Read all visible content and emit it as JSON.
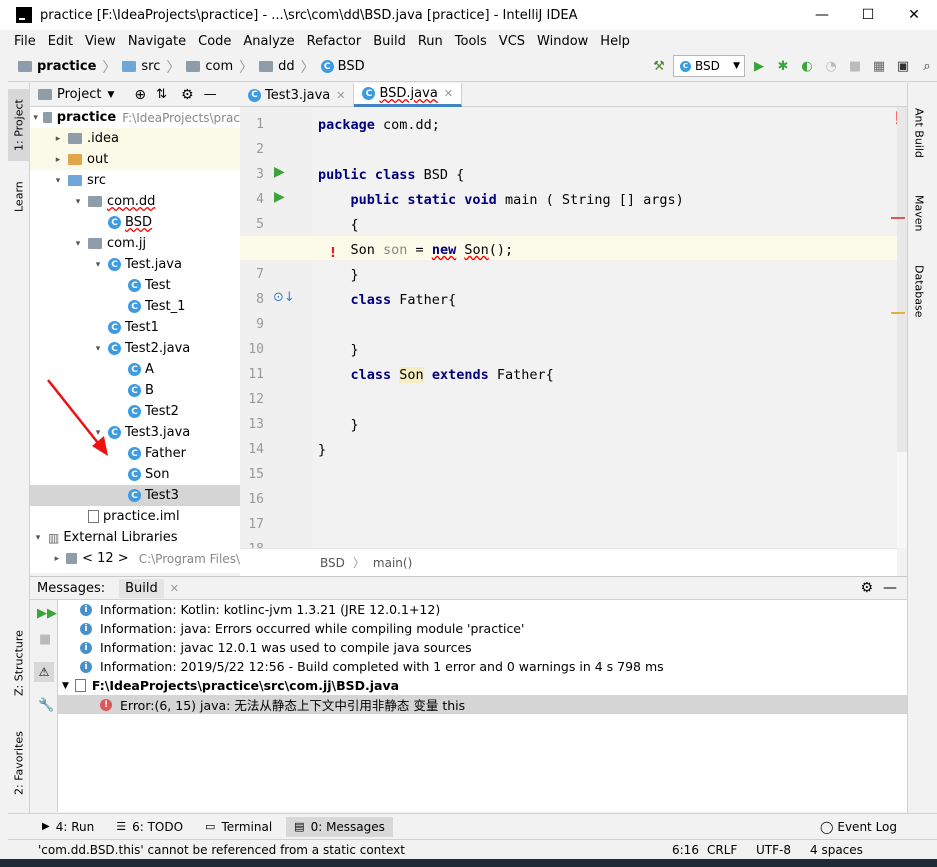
{
  "window": {
    "title": "practice [F:\\IdeaProjects\\practice] - ...\\src\\com\\dd\\BSD.java [practice] - IntelliJ IDEA",
    "minimize": "—",
    "maximize": "☐",
    "close": "✕"
  },
  "menu": [
    "File",
    "Edit",
    "View",
    "Navigate",
    "Code",
    "Analyze",
    "Refactor",
    "Build",
    "Run",
    "Tools",
    "VCS",
    "Window",
    "Help"
  ],
  "navbar": {
    "crumbs": [
      "practice",
      "src",
      "com",
      "dd",
      "BSD"
    ],
    "run_config": "BSD"
  },
  "left_tabs": [
    "1: Project",
    "Learn",
    "Z: Structure",
    "2: Favorites"
  ],
  "right_tabs": [
    "Ant Build",
    "Maven",
    "Database"
  ],
  "project": {
    "header": "Project",
    "tree": [
      {
        "label": "practice",
        "extra": "F:\\IdeaProjects\\prac",
        "icon": "folder",
        "indent": 0,
        "arrow": "▾"
      },
      {
        "label": ".idea",
        "icon": "folder",
        "indent": 1,
        "arrow": "▸"
      },
      {
        "label": "out",
        "icon": "folder-orange",
        "indent": 1,
        "arrow": "▸"
      },
      {
        "label": "src",
        "icon": "folder-blue",
        "indent": 1,
        "arrow": "▾"
      },
      {
        "label": "com.dd",
        "icon": "folder",
        "indent": 2,
        "arrow": "▾"
      },
      {
        "label": "BSD",
        "icon": "class",
        "indent": 3,
        "arrow": ""
      },
      {
        "label": "com.jj",
        "icon": "folder",
        "indent": 2,
        "arrow": "▾"
      },
      {
        "label": "Test.java",
        "icon": "class",
        "indent": 3,
        "arrow": "▾"
      },
      {
        "label": "Test",
        "icon": "class",
        "indent": 4,
        "arrow": ""
      },
      {
        "label": "Test_1",
        "icon": "class",
        "indent": 4,
        "arrow": ""
      },
      {
        "label": "Test1",
        "icon": "class",
        "indent": 3,
        "arrow": ""
      },
      {
        "label": "Test2.java",
        "icon": "class",
        "indent": 3,
        "arrow": "▾"
      },
      {
        "label": "A",
        "icon": "class",
        "indent": 4,
        "arrow": ""
      },
      {
        "label": "B",
        "icon": "class",
        "indent": 4,
        "arrow": ""
      },
      {
        "label": "Test2",
        "icon": "class",
        "indent": 4,
        "arrow": ""
      },
      {
        "label": "Test3.java",
        "icon": "class",
        "indent": 3,
        "arrow": "▾"
      },
      {
        "label": "Father",
        "icon": "class",
        "indent": 4,
        "arrow": ""
      },
      {
        "label": "Son",
        "icon": "class",
        "indent": 4,
        "arrow": ""
      },
      {
        "label": "Test3",
        "icon": "class",
        "indent": 4,
        "arrow": "",
        "selected": true
      },
      {
        "label": "practice.iml",
        "icon": "file",
        "indent": 2,
        "arrow": ""
      },
      {
        "label": "External Libraries",
        "icon": "lib",
        "indent": 0,
        "arrow": "▾"
      },
      {
        "label": "< 12 >",
        "extra": "C:\\Program Files\\",
        "icon": "folder",
        "indent": 1,
        "arrow": "▸"
      }
    ]
  },
  "editor": {
    "tabs": [
      {
        "label": "Test3.java",
        "active": false
      },
      {
        "label": "BSD.java",
        "active": true
      }
    ],
    "line_numbers": [
      "1",
      "2",
      "3",
      "4",
      "5",
      "6",
      "7",
      "8",
      "9",
      "10",
      "11",
      "12",
      "13",
      "14",
      "15",
      "16",
      "17",
      "18"
    ],
    "lines": [
      "package com.dd;",
      "",
      "public class BSD {",
      "    public static void main ( String [] args)",
      "    {",
      "    Son son = new Son();",
      "    }",
      "    class Father{",
      "",
      "    }",
      "    class Son extends Father{",
      "",
      "    }",
      "}"
    ],
    "breadcrumb": [
      "BSD",
      "main()"
    ]
  },
  "messages": {
    "tabs": [
      "Messages:",
      "Build"
    ],
    "rows": [
      {
        "type": "info",
        "text": "Information: Kotlin: kotlinc-jvm 1.3.21 (JRE 12.0.1+12)"
      },
      {
        "type": "info",
        "text": "Information: java: Errors occurred while compiling module 'practice'"
      },
      {
        "type": "info",
        "text": "Information: javac 12.0.1 was used to compile java sources"
      },
      {
        "type": "info",
        "text": "Information: 2019/5/22 12:56 - Build completed with 1 error and 0 warnings in 4 s 798 ms"
      },
      {
        "type": "file",
        "text": "F:\\IdeaProjects\\practice\\src\\com.jj\\BSD.java"
      },
      {
        "type": "error",
        "text": "Error:(6, 15)  java: 无法从静态上下文中引用非静态 变量 this"
      }
    ]
  },
  "bottom_tabs": [
    "4: Run",
    "6: TODO",
    "Terminal",
    "0: Messages"
  ],
  "event_log": "Event Log",
  "status": {
    "message": "'com.dd.BSD.this' cannot be referenced from a static context",
    "position": "6:16",
    "line_sep": "CRLF",
    "encoding": "UTF-8",
    "indent": "4 spaces"
  }
}
